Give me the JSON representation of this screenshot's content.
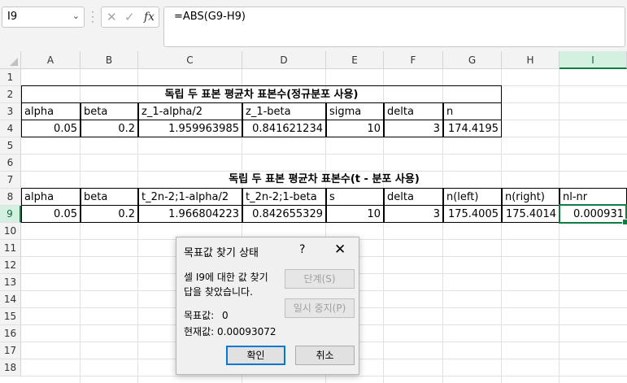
{
  "formula_bar": {
    "name_box": "I9",
    "cancel_glyph": "✕",
    "enter_glyph": "✓",
    "fx_glyph": "fx",
    "formula": "=ABS(G9-H9)"
  },
  "columns": [
    "A",
    "B",
    "C",
    "D",
    "E",
    "F",
    "G",
    "H",
    "I"
  ],
  "rows": [
    "1",
    "2",
    "3",
    "4",
    "5",
    "6",
    "7",
    "8",
    "9",
    "10",
    "11",
    "12",
    "13",
    "14",
    "15",
    "16",
    "17",
    "18"
  ],
  "table1": {
    "title": "독립 두 표본 평균차 표본수(정규분포 사용)",
    "headers": [
      "alpha",
      "beta",
      "z_1-alpha/2",
      "z_1-beta",
      "sigma",
      "delta",
      "n"
    ],
    "values": [
      "0.05",
      "0.2",
      "1.959963985",
      "0.841621234",
      "10",
      "3",
      "174.4195"
    ]
  },
  "table2": {
    "title": "독립 두 표본 평균차 표본수(t - 분포 사용)",
    "headers": [
      "alpha",
      "beta",
      "t_2n-2;1-alpha/2",
      "t_2n-2;1-beta",
      "s",
      "delta",
      "n(left)",
      "n(right)",
      "nl-nr"
    ],
    "values": [
      "0.05",
      "0.2",
      "1.966804223",
      "0.842655329",
      "10",
      "3",
      "175.4005",
      "175.4014",
      "0.000931"
    ]
  },
  "dialog": {
    "title": "목표값 찾기 상태",
    "help": "?",
    "close": "✕",
    "message_line1": "셀 I9에 대한 값 찾기",
    "message_line2": "답을 찾았습니다.",
    "target_label": "목표값:",
    "target_value": "0",
    "current_label": "현재값:",
    "current_value": "0.00093072",
    "step_button": "단계(S)",
    "pause_button": "일시 중지(P)",
    "ok_button": "확인",
    "cancel_button": "취소"
  }
}
